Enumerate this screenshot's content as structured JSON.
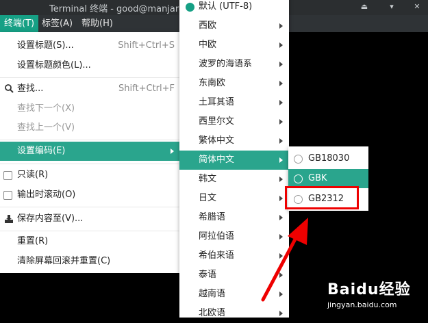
{
  "window": {
    "title": "Terminal 终端 - good@manjaro:~",
    "controls": [
      "eject-icon",
      "minimize-icon",
      "close-icon"
    ]
  },
  "menubar": {
    "items": [
      "终端(T)",
      "标签(A)",
      "帮助(H)"
    ],
    "active": "终端(T)"
  },
  "terminal_menu": {
    "items": [
      {
        "label": "设置标题(S)...",
        "accel": "Shift+Ctrl+S"
      },
      {
        "label": "设置标题颜色(L)..."
      },
      {
        "label": "查找...",
        "accel": "Shift+Ctrl+F",
        "icon": "search-icon"
      },
      {
        "label": "查找下一个(X)",
        "disabled": true
      },
      {
        "label": "查找上一个(V)",
        "disabled": true
      },
      {
        "label": "设置编码(E)",
        "submenu": true,
        "active": true
      },
      {
        "label": "只读(R)",
        "checkbox": true
      },
      {
        "label": "输出时滚动(O)",
        "checkbox": true
      },
      {
        "label": "保存内容至(V)...",
        "icon": "save-icon"
      },
      {
        "label": "重置(R)"
      },
      {
        "label": "清除屏幕回滚并重置(C)"
      }
    ]
  },
  "encoding_menu": {
    "items": [
      {
        "label": "默认 (UTF-8)",
        "radio": true,
        "selected": true
      },
      {
        "label": "西欧"
      },
      {
        "label": "中欧"
      },
      {
        "label": "波罗的海语系"
      },
      {
        "label": "东南欧"
      },
      {
        "label": "土耳其语"
      },
      {
        "label": "西里尔文"
      },
      {
        "label": "繁体中文"
      },
      {
        "label": "简体中文",
        "active": true
      },
      {
        "label": "韩文"
      },
      {
        "label": "日文"
      },
      {
        "label": "希腊语"
      },
      {
        "label": "阿拉伯语"
      },
      {
        "label": "希伯来语"
      },
      {
        "label": "泰语"
      },
      {
        "label": "越南语"
      },
      {
        "label": "北欧语"
      }
    ]
  },
  "chinese_menu": {
    "items": [
      {
        "label": "GB18030"
      },
      {
        "label": "GBK",
        "active": true
      },
      {
        "label": "GB2312",
        "highlighted": true
      }
    ]
  },
  "colors": {
    "accent": "#16a085",
    "annotation": "#e00000"
  },
  "watermark": {
    "brand": "Baidu经验",
    "url": "jingyan.baidu.com"
  }
}
